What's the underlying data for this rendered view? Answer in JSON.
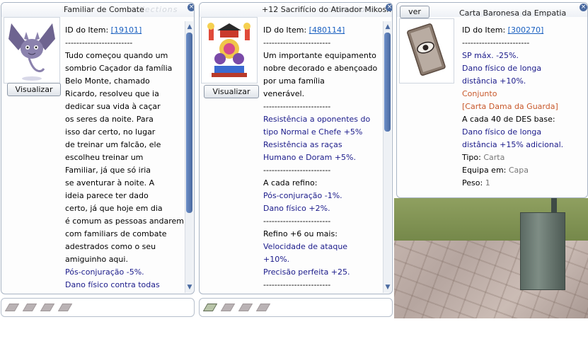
{
  "windows": [
    {
      "title": "Familiar de Combate",
      "watermark": "collections",
      "view_label": "Visualizar",
      "lines": [
        {
          "parts": [
            {
              "t": "ID do Item: ",
              "c": "blk"
            },
            {
              "t": "[19101]",
              "c": "lnk"
            }
          ]
        },
        {
          "parts": [
            {
              "t": "------------------------",
              "c": "blk"
            }
          ]
        },
        {
          "parts": [
            {
              "t": "Tudo começou quando um",
              "c": "blk"
            }
          ]
        },
        {
          "parts": [
            {
              "t": "sombrio Caçador da família",
              "c": "blk"
            }
          ]
        },
        {
          "parts": [
            {
              "t": "Belo Monte, chamado",
              "c": "blk"
            }
          ]
        },
        {
          "parts": [
            {
              "t": "Ricardo, resolveu que ia",
              "c": "blk"
            }
          ]
        },
        {
          "parts": [
            {
              "t": "dedicar sua vida à caçar",
              "c": "blk"
            }
          ]
        },
        {
          "parts": [
            {
              "t": "os seres da noite. Para",
              "c": "blk"
            }
          ]
        },
        {
          "parts": [
            {
              "t": "isso dar certo, no lugar",
              "c": "blk"
            }
          ]
        },
        {
          "parts": [
            {
              "t": "de treinar um falcão, ele",
              "c": "blk"
            }
          ]
        },
        {
          "parts": [
            {
              "t": "escolheu treinar um",
              "c": "blk"
            }
          ]
        },
        {
          "parts": [
            {
              "t": "Familiar, já que só iria",
              "c": "blk"
            }
          ]
        },
        {
          "parts": [
            {
              "t": "se aventurar à noite. A",
              "c": "blk"
            }
          ]
        },
        {
          "parts": [
            {
              "t": "ideia parece ter dado",
              "c": "blk"
            }
          ]
        },
        {
          "parts": [
            {
              "t": "certo, já que hoje em dia",
              "c": "blk"
            }
          ]
        },
        {
          "parts": [
            {
              "t": "é comum as pessoas andarem",
              "c": "blk"
            }
          ]
        },
        {
          "parts": [
            {
              "t": "com familiars de combate",
              "c": "blk"
            }
          ]
        },
        {
          "parts": [
            {
              "t": "adestrados como o seu",
              "c": "blk"
            }
          ]
        },
        {
          "parts": [
            {
              "t": "amiguinho aqui.",
              "c": "blk"
            }
          ]
        },
        {
          "parts": [
            {
              "t": "Pós-conjuração -5%.",
              "c": "blu"
            }
          ]
        },
        {
          "parts": [
            {
              "t": "Dano físico contra todas",
              "c": "blu"
            }
          ]
        }
      ]
    },
    {
      "title": "+12 Sacrifício do Atirador Mikoshi",
      "watermark": "collections",
      "view_label": "Visualizar",
      "lines": [
        {
          "parts": [
            {
              "t": "ID do Item: ",
              "c": "blk"
            },
            {
              "t": "[480114]",
              "c": "lnk"
            }
          ]
        },
        {
          "parts": [
            {
              "t": "------------------------",
              "c": "blk"
            }
          ]
        },
        {
          "parts": [
            {
              "t": "Um importante equipamento",
              "c": "blk"
            }
          ]
        },
        {
          "parts": [
            {
              "t": "nobre decorado e abençoado",
              "c": "blk"
            }
          ]
        },
        {
          "parts": [
            {
              "t": "por uma família",
              "c": "blk"
            }
          ]
        },
        {
          "parts": [
            {
              "t": "venerável.",
              "c": "blk"
            }
          ]
        },
        {
          "parts": [
            {
              "t": "------------------------",
              "c": "blk"
            }
          ]
        },
        {
          "parts": [
            {
              "t": "Resistência a oponentes do",
              "c": "blu"
            }
          ]
        },
        {
          "parts": [
            {
              "t": "tipo Normal e Chefe +5%",
              "c": "blu"
            }
          ]
        },
        {
          "parts": [
            {
              "t": "Resistência as raças",
              "c": "blu"
            }
          ]
        },
        {
          "parts": [
            {
              "t": "Humano e Doram +5%.",
              "c": "blu"
            }
          ]
        },
        {
          "parts": [
            {
              "t": "------------------------",
              "c": "blk"
            }
          ]
        },
        {
          "parts": [
            {
              "t": "A cada refino:",
              "c": "blk"
            }
          ]
        },
        {
          "parts": [
            {
              "t": "Pós-conjuração -1%.",
              "c": "blu"
            }
          ]
        },
        {
          "parts": [
            {
              "t": "Dano físico +2%.",
              "c": "blu"
            }
          ]
        },
        {
          "parts": [
            {
              "t": "------------------------",
              "c": "blk"
            }
          ]
        },
        {
          "parts": [
            {
              "t": "Refino +6 ou mais:",
              "c": "blk"
            }
          ]
        },
        {
          "parts": [
            {
              "t": "Velocidade de ataque",
              "c": "blu"
            }
          ]
        },
        {
          "parts": [
            {
              "t": "+10%.",
              "c": "blu"
            }
          ]
        },
        {
          "parts": [
            {
              "t": "Precisão perfeita +25.",
              "c": "blu"
            }
          ]
        },
        {
          "parts": [
            {
              "t": "------------------------",
              "c": "blk"
            }
          ]
        }
      ]
    },
    {
      "title": "Carta Baronesa da Empatia",
      "view_label": "ver",
      "lines": [
        {
          "parts": [
            {
              "t": "ID do Item: ",
              "c": "blk"
            },
            {
              "t": "[300270]",
              "c": "lnk"
            }
          ]
        },
        {
          "parts": [
            {
              "t": "------------------------",
              "c": "blk"
            }
          ]
        },
        {
          "parts": [
            {
              "t": "SP máx. -25%.",
              "c": "blu"
            }
          ]
        },
        {
          "parts": [
            {
              "t": "Dano físico de longa",
              "c": "blu"
            }
          ]
        },
        {
          "parts": [
            {
              "t": "distância +10%.",
              "c": "blu"
            }
          ]
        },
        {
          "parts": [
            {
              "t": "Conjunto",
              "c": "org"
            }
          ]
        },
        {
          "parts": [
            {
              "t": "[Carta Dama da Guarda]",
              "c": "org"
            }
          ]
        },
        {
          "parts": [
            {
              "t": "A cada 40 de DES base:",
              "c": "blk"
            }
          ]
        },
        {
          "parts": [
            {
              "t": "Dano físico de longa",
              "c": "blu"
            }
          ]
        },
        {
          "parts": [
            {
              "t": "distância +15% adicional.",
              "c": "blu"
            }
          ]
        },
        {
          "parts": [
            {
              "t": "Tipo: ",
              "c": "blk"
            },
            {
              "t": "Carta",
              "c": "gry"
            }
          ]
        },
        {
          "parts": [
            {
              "t": "Equipa em: ",
              "c": "blk"
            },
            {
              "t": "Capa",
              "c": "gry"
            }
          ]
        },
        {
          "parts": [
            {
              "t": "Peso: ",
              "c": "blk"
            },
            {
              "t": "1",
              "c": "gry"
            }
          ]
        }
      ]
    }
  ],
  "slots": {
    "familiar": {
      "filled": 0,
      "total": 4
    },
    "mikoshi": {
      "filled": 1,
      "total": 4
    }
  },
  "colors": {
    "blue_text": "#1a1a8a",
    "orange_text": "#c8582a",
    "link": "#1a60c0",
    "scroll_thumb": "#4a6aa0"
  },
  "icons": {
    "close": "close-icon",
    "scroll_up": "scroll-up-icon",
    "scroll_down": "scroll-down-icon"
  }
}
